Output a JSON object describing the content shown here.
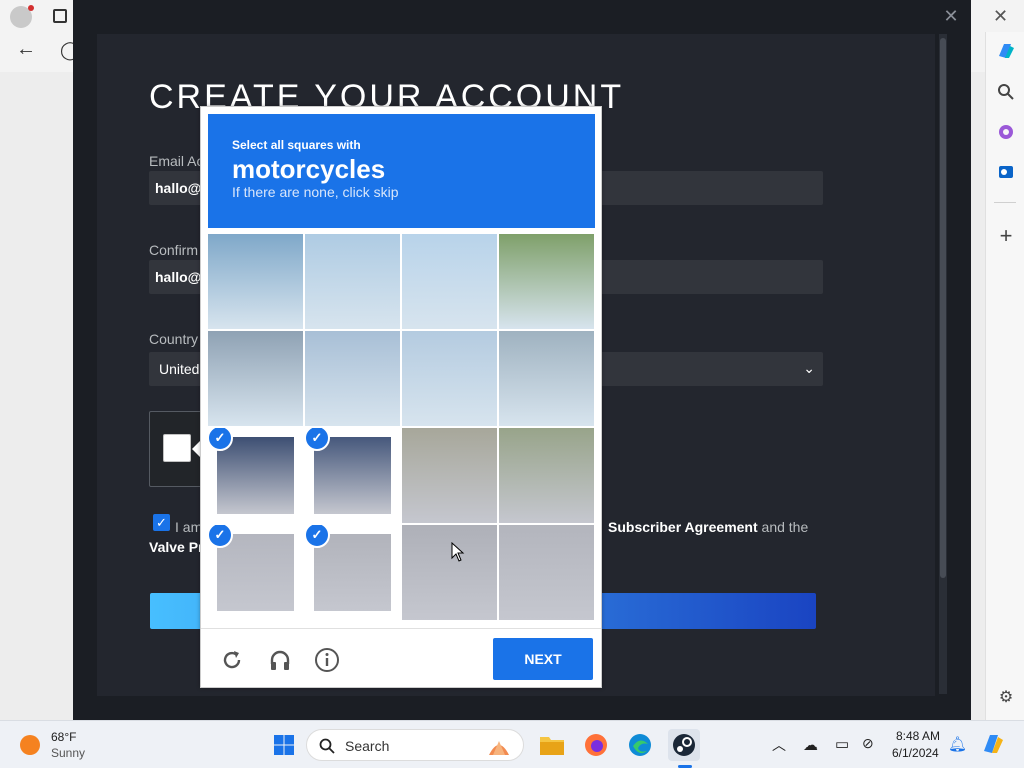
{
  "steam": {
    "title": "CREATE YOUR ACCOUNT",
    "email_label": "Email Ac",
    "email_value": "hallo@s",
    "confirm_label": "Confirm",
    "confirm_value": "hallo@s",
    "country_label": "Country",
    "country_value": "United",
    "agree_text_1": "I am",
    "agree_text_2": "Valve Pr",
    "agree_link": "Subscriber Agreement",
    "agree_suffix": " and the"
  },
  "recaptcha": {
    "instruction": "Select all squares with",
    "target": "motorcycles",
    "hint": "If there are none, click skip",
    "next_label": "NEXT",
    "selected_tiles": [
      8,
      9,
      12,
      13
    ]
  },
  "taskbar": {
    "temperature": "68°F",
    "weather": "Sunny",
    "search_label": "Search",
    "time": "8:48 AM",
    "date": "6/1/2024"
  },
  "icons": {
    "reload": "reload-icon",
    "audio": "headphones-icon",
    "info": "info-icon"
  },
  "colors": {
    "accent": "#1a73e8",
    "steam_bg": "#1b1e24"
  }
}
